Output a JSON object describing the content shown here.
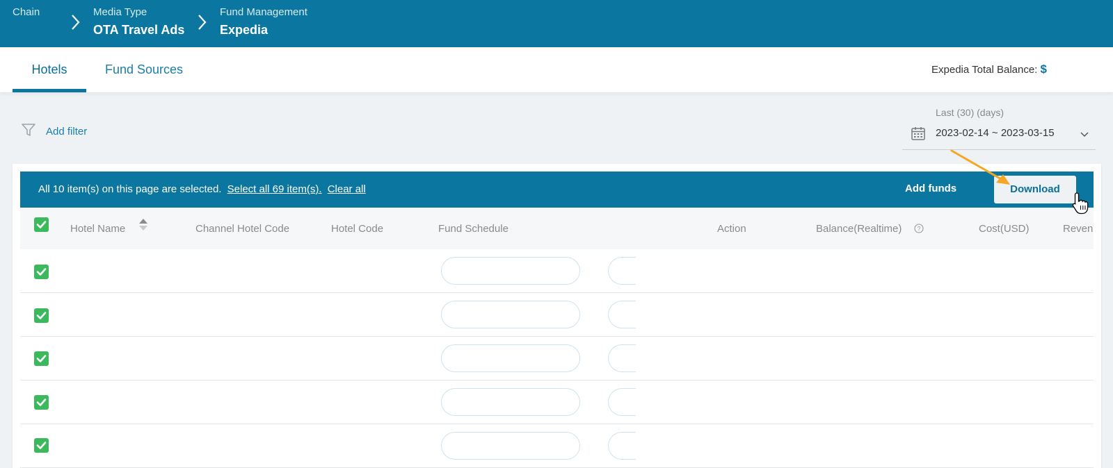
{
  "breadcrumb": [
    {
      "label": "Chain",
      "value": ""
    },
    {
      "label": "Media Type",
      "value": "OTA Travel Ads"
    },
    {
      "label": "Fund Management",
      "value": "Expedia"
    }
  ],
  "tabs": [
    {
      "label": "Hotels",
      "active": true
    },
    {
      "label": "Fund Sources",
      "active": false
    }
  ],
  "balance": {
    "label": "Expedia Total Balance:",
    "currency": "$"
  },
  "filter": {
    "label": "Add filter"
  },
  "date_range": {
    "label": "Last (30) (days)",
    "value": "2023-02-14 ~ 2023-03-15"
  },
  "selection_bar": {
    "message": "All 10 item(s) on this page are selected.",
    "select_all": "Select all 69 item(s).",
    "clear_all": "Clear all",
    "add_funds": "Add funds",
    "download": "Download"
  },
  "table": {
    "columns": [
      "Hotel Name",
      "Channel Hotel Code",
      "Hotel Code",
      "Fund Schedule",
      "Action",
      "Balance(Realtime)",
      "Cost(USD)",
      "Revenue"
    ],
    "rows_visible": 5,
    "all_rows_checked": true
  },
  "colors": {
    "brand": "#0b77a0",
    "checkbox": "#3cb95c",
    "arrow": "#f5a623"
  }
}
